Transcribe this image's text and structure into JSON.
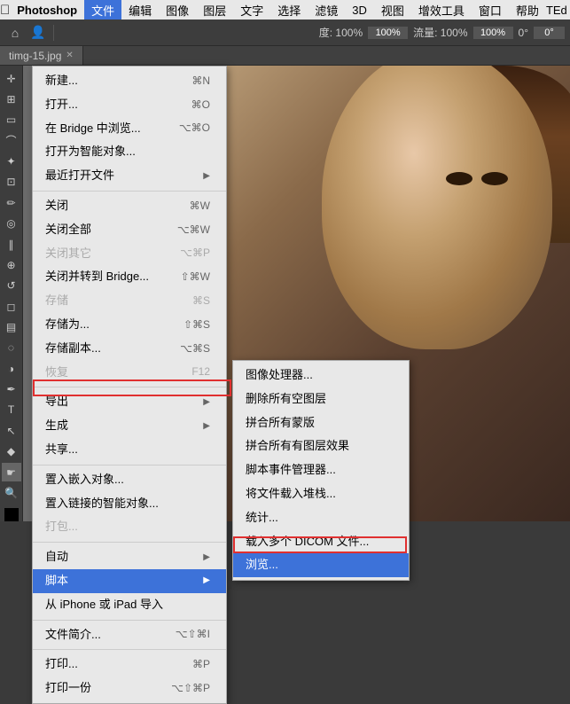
{
  "app": {
    "name": "Photoshop",
    "apple_icon": "&#63743;"
  },
  "menubar": {
    "items": [
      {
        "label": "文件",
        "active": true
      },
      {
        "label": "编辑"
      },
      {
        "label": "图像"
      },
      {
        "label": "图层"
      },
      {
        "label": "文字"
      },
      {
        "label": "选择"
      },
      {
        "label": "滤镜"
      },
      {
        "label": "3D"
      },
      {
        "label": "视图"
      },
      {
        "label": "增效工具"
      },
      {
        "label": "窗口"
      },
      {
        "label": "帮助"
      }
    ],
    "right": "TEd"
  },
  "toolbar": {
    "zoom_label": "度: 100%",
    "flow_label": "流量: 100%",
    "angle_label": "0°"
  },
  "tab": {
    "label": "timg-15.jpg"
  },
  "file_menu": {
    "items": [
      {
        "label": "新建...",
        "shortcut": "⌘N",
        "type": "item"
      },
      {
        "label": "打开...",
        "shortcut": "⌘O",
        "type": "item"
      },
      {
        "label": "在 Bridge 中浏览...",
        "shortcut": "⌥⌘O",
        "type": "item"
      },
      {
        "label": "打开为智能对象...",
        "type": "item"
      },
      {
        "label": "最近打开文件",
        "arrow": true,
        "type": "item"
      },
      {
        "type": "sep"
      },
      {
        "label": "关闭",
        "shortcut": "⌘W",
        "type": "item"
      },
      {
        "label": "关闭全部",
        "shortcut": "⌥⌘W",
        "type": "item"
      },
      {
        "label": "关闭其它",
        "shortcut": "⌥⌘P",
        "disabled": true,
        "type": "item"
      },
      {
        "label": "关闭并转到 Bridge...",
        "shortcut": "⇧⌘W",
        "type": "item"
      },
      {
        "label": "存储",
        "shortcut": "⌘S",
        "disabled": true,
        "type": "item"
      },
      {
        "label": "存储为...",
        "shortcut": "⇧⌘S",
        "type": "item"
      },
      {
        "label": "存储副本...",
        "shortcut": "⌥⌘S",
        "type": "item"
      },
      {
        "label": "恢复",
        "shortcut": "F12",
        "disabled": true,
        "type": "item"
      },
      {
        "type": "sep"
      },
      {
        "label": "导出",
        "arrow": true,
        "type": "item"
      },
      {
        "label": "生成",
        "arrow": true,
        "type": "item"
      },
      {
        "label": "共享...",
        "type": "item"
      },
      {
        "type": "sep"
      },
      {
        "label": "置入嵌入对象...",
        "type": "item"
      },
      {
        "label": "置入链接的智能对象...",
        "type": "item"
      },
      {
        "label": "打包...",
        "disabled": true,
        "type": "item"
      },
      {
        "type": "sep"
      },
      {
        "label": "自动",
        "arrow": true,
        "type": "item"
      },
      {
        "label": "脚本",
        "arrow": true,
        "type": "item",
        "highlighted": true
      },
      {
        "label": "从 iPhone 或 iPad 导入",
        "type": "item"
      },
      {
        "type": "sep"
      },
      {
        "label": "文件简介...",
        "shortcut": "⌥⇧⌘I",
        "type": "item"
      },
      {
        "type": "sep"
      },
      {
        "label": "打印...",
        "shortcut": "⌘P",
        "type": "item"
      },
      {
        "label": "打印一份",
        "shortcut": "⌥⇧⌘P",
        "type": "item"
      }
    ]
  },
  "script_submenu": {
    "items": [
      {
        "label": "图像处理器..."
      },
      {
        "label": "删除所有空图层"
      },
      {
        "label": "拼合所有蒙版"
      },
      {
        "label": "拼合所有有图层效果"
      },
      {
        "label": "脚本事件管理器..."
      },
      {
        "label": "将文件载入堆栈..."
      },
      {
        "label": "统计..."
      },
      {
        "label": "载入多个 DICOM 文件..."
      },
      {
        "label": "浏览...",
        "active": true
      }
    ]
  }
}
